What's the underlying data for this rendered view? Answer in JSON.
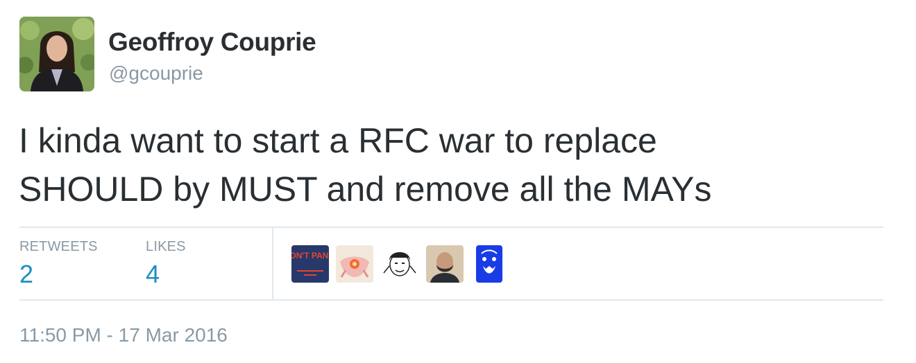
{
  "author": {
    "name": "Geoffroy Couprie",
    "handle": "@gcouprie"
  },
  "tweet": {
    "text_line1": "I kinda want to start a RFC war to replace",
    "text_line2": "SHOULD by MUST and remove all the MAYs"
  },
  "stats": {
    "retweets_label": "RETWEETS",
    "retweets_count": "2",
    "likes_label": "LIKES",
    "likes_count": "4"
  },
  "likers": [
    {
      "icon": "dont-panic-avatar",
      "text": "DON'T PANIC"
    },
    {
      "icon": "pink-creature-avatar"
    },
    {
      "icon": "sketch-face-avatar"
    },
    {
      "icon": "bearded-man-avatar"
    },
    {
      "icon": "blue-face-avatar"
    }
  ],
  "timestamp": "11:50 PM - 17 Mar 2016",
  "colors": {
    "text": "#292f33",
    "muted": "#8899a6",
    "accent": "#1b8fc1",
    "divider": "#e1e8ed"
  }
}
